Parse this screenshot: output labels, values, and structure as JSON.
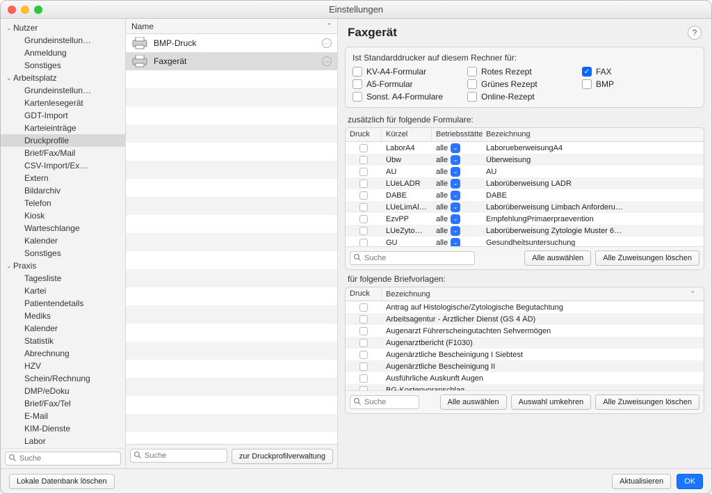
{
  "window": {
    "title": "Einstellungen"
  },
  "sidebar": {
    "search_placeholder": "Suche",
    "groups": [
      {
        "label": "Nutzer",
        "items": [
          "Grundeinstellun…",
          "Anmeldung",
          "Sonstiges"
        ]
      },
      {
        "label": "Arbeitsplatz",
        "items": [
          "Grundeinstellun…",
          "Kartenlesegerät",
          "GDT-Import",
          "Karteieinträge",
          "Druckprofile",
          "Brief/Fax/Mail",
          "CSV-Import/Ex…",
          "Extern",
          "Bildarchiv",
          "Telefon",
          "Kiosk",
          "Warteschlange",
          "Kalender",
          "Sonstiges"
        ],
        "selected": "Druckprofile"
      },
      {
        "label": "Praxis",
        "items": [
          "Tagesliste",
          "Kartei",
          "Patientendetails",
          "Mediks",
          "Kalender",
          "Statistik",
          "Abrechnung",
          "HZV",
          "Schein/Rechnung",
          "DMP/eDoku",
          "Brief/Fax/Tel",
          "E-Mail",
          "KIM-Dienste",
          "Labor"
        ]
      }
    ]
  },
  "middle": {
    "header": "Name",
    "rows": [
      {
        "label": "BMP-Druck",
        "selected": false
      },
      {
        "label": "Faxgerät",
        "selected": true
      }
    ],
    "search_placeholder": "Suche",
    "button": "zur Druckprofilverwaltung"
  },
  "right": {
    "title": "Faxgerät",
    "help": "?",
    "default_printer_label": "Ist Standarddrucker auf diesem Rechner für:",
    "default_printer_checks": [
      {
        "label": "KV-A4-Formular",
        "on": false
      },
      {
        "label": "A5-Formular",
        "on": false
      },
      {
        "label": "Sonst. A4-Formulare",
        "on": false
      },
      {
        "label": "Rotes Rezept",
        "on": false
      },
      {
        "label": "Grünes Rezept",
        "on": false
      },
      {
        "label": "Online-Rezept",
        "on": false
      },
      {
        "label": "FAX",
        "on": true
      },
      {
        "label": "BMP",
        "on": false
      }
    ],
    "forms_label": "zusätzlich für folgende Formulare:",
    "forms_headers": {
      "druck": "Druck",
      "kuerzel": "Kürzel",
      "bs": "Betriebsstätte",
      "bez": "Bezeichnung"
    },
    "forms_rows": [
      {
        "kuerzel": "LaborA4",
        "bs": "alle",
        "bez": "LaborueberweisungA4"
      },
      {
        "kuerzel": "Übw",
        "bs": "alle",
        "bez": "Überweisung"
      },
      {
        "kuerzel": "AU",
        "bs": "alle",
        "bez": "AU"
      },
      {
        "kuerzel": "LUeLADR",
        "bs": "alle",
        "bez": "Laborüberweisung LADR"
      },
      {
        "kuerzel": "DABE",
        "bs": "alle",
        "bez": "DABE"
      },
      {
        "kuerzel": "LUeLimAl…",
        "bs": "alle",
        "bez": "Laborüberweisung Limbach Anforderu…"
      },
      {
        "kuerzel": "EzvPP",
        "bs": "alle",
        "bez": "EmpfehlungPrimaerpraevention"
      },
      {
        "kuerzel": "LUeZyto…",
        "bs": "alle",
        "bez": "Laborüberweisung Zytologie Muster 6…"
      },
      {
        "kuerzel": "GU",
        "bs": "alle",
        "bez": "Gesundheitsuntersuchung"
      }
    ],
    "forms_foot": {
      "search_placeholder": "Suche",
      "btn_all": "Alle auswählen",
      "btn_clear": "Alle Zuweisungen löschen"
    },
    "letters_label": "für folgende Briefvorlagen:",
    "letters_headers": {
      "druck": "Druck",
      "bez": "Bezeichnung"
    },
    "letters_rows": [
      "Antrag auf Histologische/Zytologische Begutachtung",
      "Arbeitsagentur - Ärztlicher Dienst (GS 4 ÄD)",
      "Augenarzt Führerscheingutachten Sehvermögen",
      "Augenarztbericht (F1030)",
      "Augenärztliche Bescheinigung I Siebtest",
      "Augenärztliche Bescheinigung II",
      "Ausführliche Auskunft Augen",
      "BG-Kostenvoranschlag"
    ],
    "letters_foot": {
      "search_placeholder": "Suche",
      "btn_all": "Alle auswählen",
      "btn_inv": "Auswahl umkehren",
      "btn_clear": "Alle Zuweisungen löschen"
    }
  },
  "footer": {
    "local_db": "Lokale Datenbank löschen",
    "refresh": "Aktualisieren",
    "ok": "OK"
  }
}
